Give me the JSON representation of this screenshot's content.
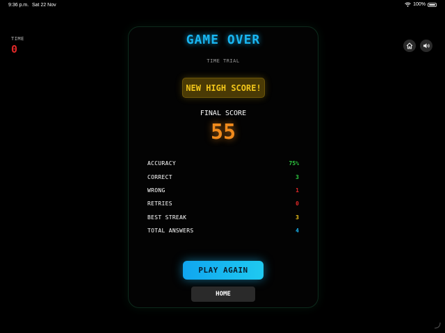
{
  "status_bar": {
    "time": "9:36 p.m.",
    "date": "Sat 22 Nov",
    "battery": "100%"
  },
  "timer": {
    "label": "TIME",
    "value": "0"
  },
  "buttons": {
    "home_icon": "home-icon",
    "sound_icon": "speaker-icon"
  },
  "result": {
    "title": "GAME OVER",
    "mode": "TIME TRIAL",
    "badge": "NEW HIGH SCORE!",
    "final_score_label": "FINAL SCORE",
    "final_score": "55"
  },
  "stats": [
    {
      "label": "ACCURACY",
      "value": "75%",
      "color": "#2ecc40"
    },
    {
      "label": "CORRECT",
      "value": "3",
      "color": "#2ecc40"
    },
    {
      "label": "WRONG",
      "value": "1",
      "color": "#e02828"
    },
    {
      "label": "RETRIES",
      "value": "0",
      "color": "#e02828"
    },
    {
      "label": "BEST STREAK",
      "value": "3",
      "color": "#f2c61a"
    },
    {
      "label": "TOTAL ANSWERS",
      "value": "4",
      "color": "#19b6f2"
    }
  ],
  "actions": {
    "play_again": "PLAY AGAIN",
    "home": "HOME"
  },
  "colors": {
    "accent": "#19b6f2",
    "score": "#f08a1c",
    "highlight": "#f2c61a",
    "danger": "#e02828"
  }
}
